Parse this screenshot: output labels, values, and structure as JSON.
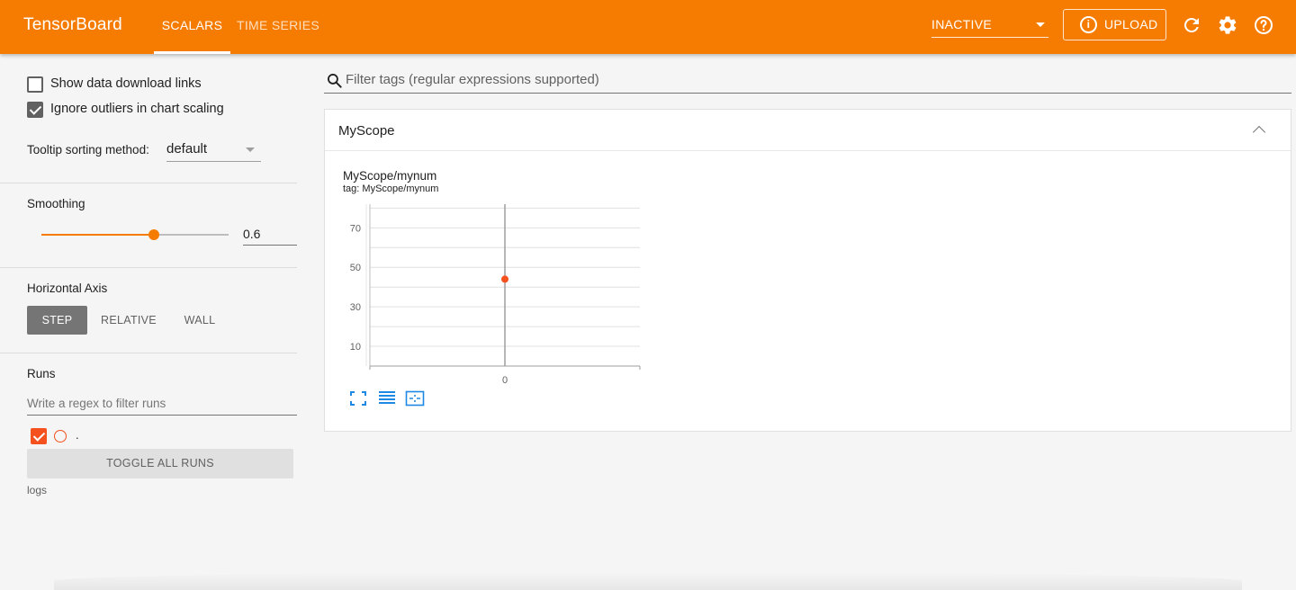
{
  "app": {
    "title": "TensorBoard"
  },
  "header": {
    "tabs": [
      {
        "label": "SCALARS",
        "active": true
      },
      {
        "label": "TIME SERIES",
        "active": false
      }
    ],
    "run_status": "INACTIVE",
    "upload_label": "UPLOAD",
    "icons": [
      "info-icon",
      "refresh-icon",
      "settings-icon",
      "help-icon"
    ]
  },
  "sidebar": {
    "show_download_links": {
      "label": "Show data download links",
      "checked": false
    },
    "ignore_outliers": {
      "label": "Ignore outliers in chart scaling",
      "checked": true
    },
    "tooltip_sorting": {
      "label": "Tooltip sorting method:",
      "value": "default"
    },
    "smoothing": {
      "label": "Smoothing",
      "value": "0.6",
      "fraction": 0.6
    },
    "horizontal_axis": {
      "label": "Horizontal Axis",
      "options": [
        "STEP",
        "RELATIVE",
        "WALL"
      ],
      "selected": "STEP"
    },
    "runs": {
      "label": "Runs",
      "filter_placeholder": "Write a regex to filter runs",
      "items": [
        {
          "name": ".",
          "checked": true,
          "color": "#f4511e"
        }
      ],
      "toggle_label": "TOGGLE ALL RUNS",
      "logdir": "logs"
    }
  },
  "main": {
    "filter_placeholder": "Filter tags (regular expressions supported)",
    "category": {
      "title": "MyScope",
      "expanded": true,
      "chart": {
        "title": "MyScope/mynum",
        "tag": "tag: MyScope/mynum"
      }
    }
  },
  "colors": {
    "accent": "#f57c00",
    "run": "#f4511e",
    "chart_icons": "#1e88e5"
  },
  "chart_data": {
    "type": "scatter",
    "title": "MyScope/mynum",
    "subtitle": "tag: MyScope/mynum",
    "x_ticks": [
      "0"
    ],
    "y_ticks": [
      "10",
      "30",
      "50",
      "70"
    ],
    "ylim": [
      0,
      82
    ],
    "series": [
      {
        "x": [
          0
        ],
        "y": [
          44
        ]
      }
    ],
    "grid": true
  }
}
